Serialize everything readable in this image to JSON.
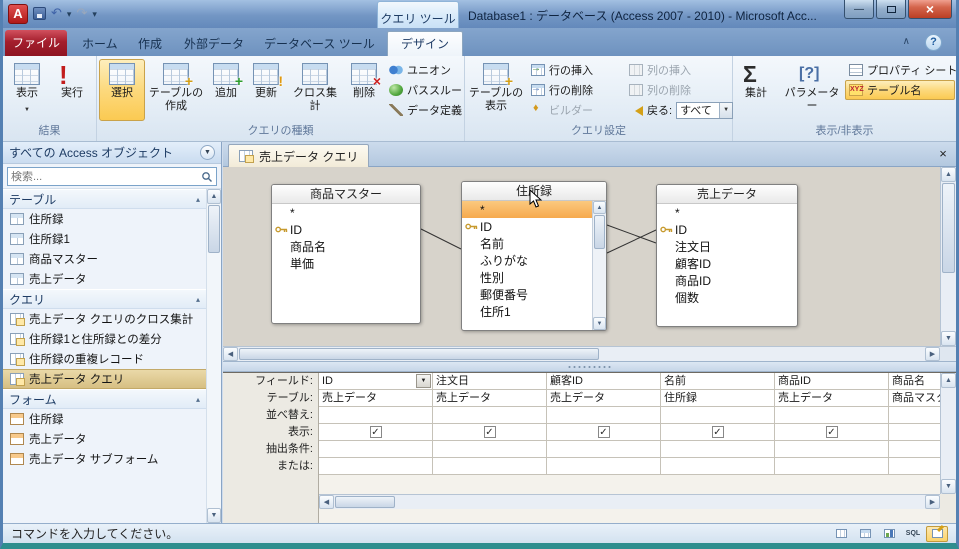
{
  "titlebar": {
    "title": "Database1 : データベース (Access 2007 - 2010) - Microsoft Acc..."
  },
  "ribbon_tabs": {
    "file": "ファイル",
    "home": "ホーム",
    "create": "作成",
    "external_data": "外部データ",
    "database_tools": "データベース ツール",
    "contextual": "クエリ ツール",
    "design": "デザイン"
  },
  "ribbon": {
    "results": {
      "label": "結果",
      "view": "表示",
      "run": "実行"
    },
    "query_type": {
      "label": "クエリの種類",
      "select": "選択",
      "make_table": "テーブルの作成",
      "append": "追加",
      "update": "更新",
      "crosstab": "クロス集計",
      "delete": "削除",
      "union": "ユニオン",
      "pass_through": "パススルー",
      "data_definition": "データ定義"
    },
    "query_setup": {
      "label": "クエリ設定",
      "show_table": "テーブルの表示",
      "insert_rows": "行の挿入",
      "delete_rows": "行の削除",
      "builder": "ビルダー",
      "insert_columns": "列の挿入",
      "delete_columns": "列の削除",
      "return_label": "戻る:",
      "return_value": "すべて"
    },
    "show_hide": {
      "label": "表示/非表示",
      "totals": "集計",
      "parameters": "パラメーター",
      "property_sheet": "プロパティ シート",
      "table_names": "テーブル名"
    }
  },
  "nav": {
    "header": "すべての Access オブジェクト",
    "search_placeholder": "検索...",
    "groups": [
      {
        "label": "テーブル",
        "items": [
          "住所録",
          "住所録1",
          "商品マスター",
          "売上データ"
        ]
      },
      {
        "label": "クエリ",
        "items": [
          "売上データ クエリのクロス集計",
          "住所録1と住所録との差分",
          "住所録の重複レコード",
          "売上データ クエリ"
        ],
        "selected_item": "売上データ クエリ"
      },
      {
        "label": "フォーム",
        "items": [
          "住所録",
          "売上データ",
          "売上データ サブフォーム"
        ]
      }
    ]
  },
  "document": {
    "tab_title": "売上データ クエリ",
    "tables": [
      {
        "title": "商品マスター",
        "fields": [
          "*",
          "ID",
          "商品名",
          "単価"
        ],
        "key_field": "ID"
      },
      {
        "title": "住所録",
        "fields": [
          "*",
          "ID",
          "名前",
          "ふりがな",
          "性別",
          "郵便番号",
          "住所1"
        ],
        "key_field": "ID",
        "selected_field": "*"
      },
      {
        "title": "売上データ",
        "fields": [
          "*",
          "ID",
          "注文日",
          "顧客ID",
          "商品ID",
          "個数"
        ],
        "key_field": "ID"
      }
    ],
    "grid": {
      "row_labels": [
        "フィールド:",
        "テーブル:",
        "並べ替え:",
        "表示:",
        "抽出条件:",
        "または:"
      ],
      "columns": [
        {
          "field": "ID",
          "table": "売上データ",
          "show": true
        },
        {
          "field": "注文日",
          "table": "売上データ",
          "show": true
        },
        {
          "field": "顧客ID",
          "table": "売上データ",
          "show": true
        },
        {
          "field": "名前",
          "table": "住所録",
          "show": true
        },
        {
          "field": "商品ID",
          "table": "売上データ",
          "show": true
        },
        {
          "field": "商品名",
          "table": "商品マスター",
          "show": true
        }
      ]
    }
  },
  "statusbar": {
    "message": "コマンドを入力してください。",
    "sql_label": "SQL"
  },
  "colors": {
    "titlebar": "#7396c4",
    "file_tab": "#a41e2d",
    "ribbon_selection": "#fbd36b",
    "nav_selection": "#d9c183",
    "field_highlight": "#f6a94e",
    "contextual_tab_bg": "#d8eafa"
  },
  "icons": [
    "access-app-icon",
    "save-icon",
    "undo-icon",
    "redo-icon",
    "qat-dropdown-icon",
    "minimize-icon",
    "maximize-icon",
    "close-icon",
    "ribbon-collapse-icon",
    "help-icon",
    "search-icon",
    "nav-dropdown-icon",
    "chevron-up-icon",
    "table-icon",
    "query-icon",
    "form-icon",
    "key-icon",
    "checkmark-icon",
    "sigma-icon",
    "parameter-icon",
    "xyz-table-names-icon",
    "property-sheet-icon",
    "union-icon",
    "pass-through-icon",
    "pencil-icon",
    "builder-icon",
    "return-arrow-icon",
    "mouse-cursor",
    "datasheet-view-icon",
    "pivottable-view-icon",
    "pivotchart-view-icon",
    "design-view-icon"
  ]
}
